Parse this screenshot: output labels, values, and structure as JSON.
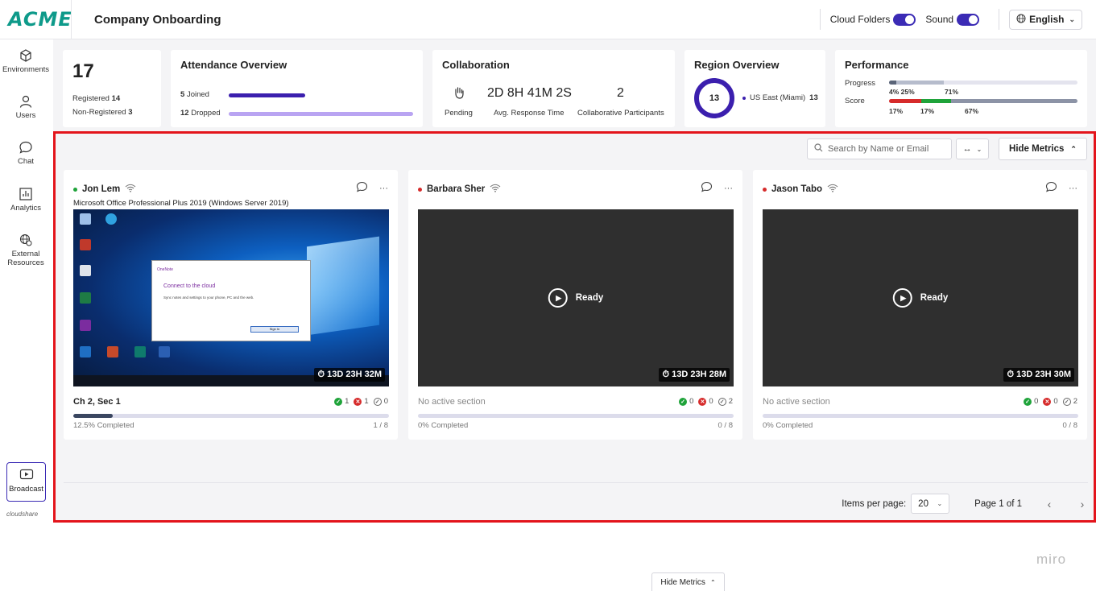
{
  "header": {
    "logo": "ACME",
    "title": "Company Onboarding",
    "cloud_folders_label": "Cloud Folders",
    "sound_label": "Sound",
    "language": "English"
  },
  "sidebar": {
    "items": [
      {
        "label": "Environments",
        "icon": "cube-icon"
      },
      {
        "label": "Users",
        "icon": "user-icon"
      },
      {
        "label": "Chat",
        "icon": "chat-icon"
      },
      {
        "label": "Analytics",
        "icon": "analytics-icon"
      },
      {
        "label": "External Resources",
        "icon": "globe-icon"
      }
    ],
    "broadcast_label": "Broadcast",
    "brand": "cloudshare"
  },
  "metrics": {
    "registration": {
      "total": "17",
      "registered_label": "Registered",
      "registered": "14",
      "non_registered_label": "Non-Registered",
      "non_registered": "3"
    },
    "attendance": {
      "title": "Attendance Overview",
      "joined_count": "5",
      "joined_label": "Joined",
      "dropped_count": "12",
      "dropped_label": "Dropped",
      "joined_fraction": 0.42,
      "dropped_fraction": 1.0
    },
    "collaboration": {
      "title": "Collaboration",
      "pending_label": "Pending",
      "response_time": "2D 8H 41M 2S",
      "response_label": "Avg. Response Time",
      "participants": "2",
      "participants_label": "Collaborative Participants"
    },
    "region": {
      "title": "Region Overview",
      "total": "13",
      "region_label": "US East (Miami)",
      "region_count": "13"
    },
    "performance": {
      "title": "Performance",
      "progress_label": "Progress",
      "score_label": "Score",
      "progress_pct_a": "4%",
      "progress_pct_b": "25%",
      "progress_pct_c": "71%",
      "score_pct_a": "17%",
      "score_pct_b": "17%",
      "score_pct_c": "67%"
    }
  },
  "toolbar": {
    "search_placeholder": "Search by Name or Email",
    "width_toggle": "↔",
    "hide_metrics": "Hide Metrics"
  },
  "participants": [
    {
      "name": "Jon Lem",
      "status_color": "#1fa33a",
      "subtitle": "Microsoft Office Professional Plus 2019 (Windows Server 2019)",
      "timer": "13D 23H 32M",
      "section": "Ch 2, Sec 1",
      "ok": "1",
      "bad": "1",
      "neutral": "0",
      "completed_label": "12.5% Completed",
      "completed_fraction": 0.125,
      "count": "1 / 8",
      "screen": "desktop",
      "dialog_app": "OneNote",
      "dialog_title": "Connect to the cloud",
      "dialog_body": "Sync notes and settings to your phone, PC and the web.",
      "dialog_button": "Sign In"
    },
    {
      "name": "Barbara Sher",
      "status_color": "#d62b2b",
      "subtitle": "",
      "timer": "13D 23H 28M",
      "section": "No active section",
      "ok": "0",
      "bad": "0",
      "neutral": "2",
      "completed_label": "0% Completed",
      "completed_fraction": 0,
      "count": "0 / 8",
      "screen": "ready",
      "ready_label": "Ready"
    },
    {
      "name": "Jason Tabo",
      "status_color": "#d62b2b",
      "subtitle": "",
      "timer": "13D 23H 30M",
      "section": "No active section",
      "ok": "0",
      "bad": "0",
      "neutral": "2",
      "completed_label": "0% Completed",
      "completed_fraction": 0,
      "count": "0 / 8",
      "screen": "ready",
      "ready_label": "Ready"
    }
  ],
  "pagination": {
    "items_per_page_label": "Items per page:",
    "items_per_page": "20",
    "page_info": "Page 1 of 1"
  },
  "footer": {
    "watermark": "miro",
    "hide_metrics": "Hide Metrics"
  },
  "colors": {
    "accent": "#3b2bb5",
    "brand": "#0e9a8a",
    "highlight_border": "#e3141b"
  }
}
